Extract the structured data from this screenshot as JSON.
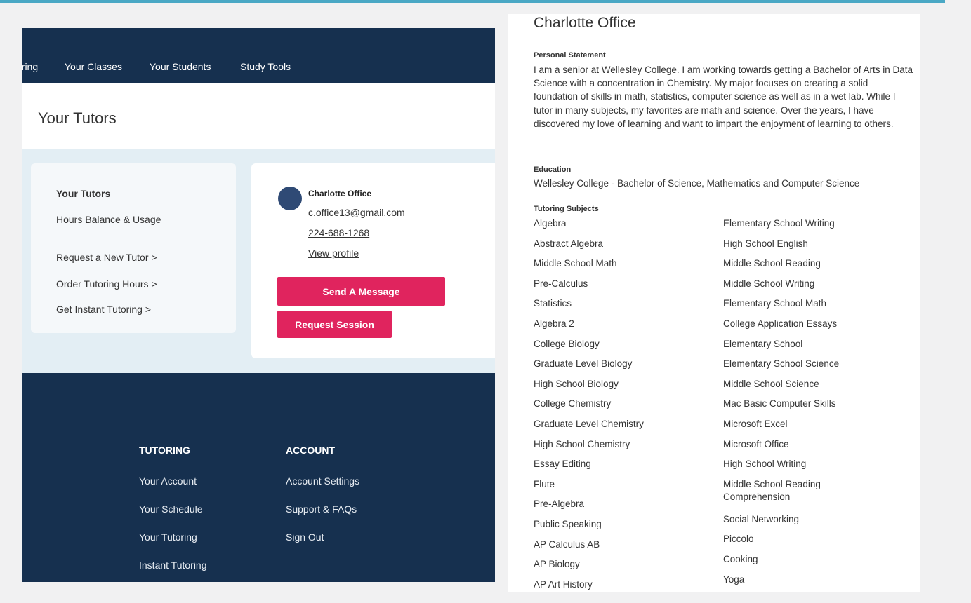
{
  "nav": {
    "items": [
      "oring",
      "Your Classes",
      "Your Students",
      "Study Tools"
    ]
  },
  "page": {
    "title": "Your Tutors"
  },
  "sidebar": {
    "items": [
      {
        "label": "Your Tutors"
      },
      {
        "label": "Hours Balance & Usage"
      },
      {
        "label": "Request a New Tutor  >"
      },
      {
        "label": "Order Tutoring Hours  >"
      },
      {
        "label": "Get Instant Tutoring  >"
      }
    ]
  },
  "tutor_card": {
    "name": "Charlotte Office",
    "email": "c.office13@gmail.com",
    "phone": "224-688-1268",
    "view_profile": "View profile",
    "send_message": "Send A Message",
    "request_session": "Request Session"
  },
  "footer": {
    "tutoring": {
      "heading": "TUTORING",
      "links": [
        "Your Account",
        "Your Schedule",
        "Your Tutoring",
        "Instant Tutoring"
      ]
    },
    "account": {
      "heading": "ACCOUNT",
      "links": [
        "Account Settings",
        "Support & FAQs",
        "Sign Out"
      ]
    }
  },
  "profile": {
    "name": "Charlotte Office",
    "statement_label": "Personal Statement",
    "statement": "I am a senior at Wellesley College. I am working towards getting a Bachelor of Arts in Data Science with a concentration in Chemistry. My major focuses on creating a solid foundation of skills in math, statistics, computer science as well as in a wet lab. While I tutor in many subjects, my favorites are math and science. Over the years, I have discovered my love of learning and want to impart the enjoyment of learning to others.",
    "education_label": "Education",
    "education": "Wellesley College - Bachelor of Science, Mathematics and Computer Science",
    "subjects_label": "Tutoring Subjects",
    "subjects_left": [
      "Algebra",
      "Abstract Algebra",
      "Middle School Math",
      "Pre-Calculus",
      "Statistics",
      "Algebra 2",
      "College Biology",
      "Graduate Level Biology",
      "High School Biology",
      "College Chemistry",
      "Graduate Level Chemistry",
      "High School Chemistry",
      "Essay Editing",
      "Flute",
      "Pre-Algebra",
      "Public Speaking",
      "AP Calculus AB",
      "AP Biology",
      "AP Art History"
    ],
    "subjects_right": [
      "Elementary School Writing",
      "High School English",
      "Middle School Reading",
      "Middle School Writing",
      "Elementary School Math",
      "College Application Essays",
      "Elementary School",
      "Elementary School Science",
      "Middle School Science",
      "Mac Basic Computer Skills",
      "Microsoft Excel",
      "Microsoft Office",
      "High School Writing",
      "Middle School Reading Comprehension",
      "Social Networking",
      "Piccolo",
      "Cooking",
      "Yoga"
    ]
  },
  "colors": {
    "navy": "#16304f",
    "accent_pink": "#e0245e",
    "top_rule": "#4aa8c5",
    "avatar": "#2f4a75"
  }
}
